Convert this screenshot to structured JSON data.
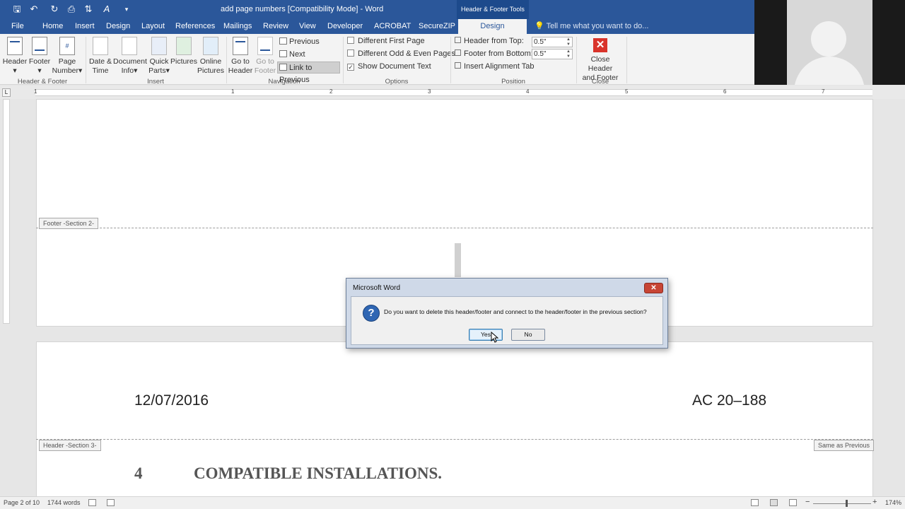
{
  "window": {
    "doc_title": "add page numbers [Compatibility Mode] - Word",
    "contextual_tab_group": "Header & Footer Tools",
    "qat": {
      "save": "🖫",
      "undo": "↶",
      "redo": "↻",
      "preview": "⎙",
      "sort": "⇅",
      "font": "A",
      "more": "▾"
    }
  },
  "tabs": [
    "File",
    "Home",
    "Insert",
    "Design",
    "Layout",
    "References",
    "Mailings",
    "Review",
    "View",
    "Developer",
    "ACROBAT",
    "SecureZIP",
    "Design"
  ],
  "tell_me": "Tell me what you want to do...",
  "ribbon": {
    "header_footer": {
      "header": "Header",
      "footer": "Footer",
      "page_number_1": "Page",
      "page_number_2": "Number",
      "group": "Header & Footer"
    },
    "insert": {
      "date_time_1": "Date &",
      "date_time_2": "Time",
      "doc_info_1": "Document",
      "doc_info_2": "Info",
      "quick_parts_1": "Quick",
      "quick_parts_2": "Parts",
      "pictures": "Pictures",
      "online_pictures_1": "Online",
      "online_pictures_2": "Pictures",
      "group": "Insert"
    },
    "navigation": {
      "go_to_header_1": "Go to",
      "go_to_header_2": "Header",
      "go_to_footer_1": "Go to",
      "go_to_footer_2": "Footer",
      "previous": "Previous",
      "next": "Next",
      "link_to_previous": "Link to Previous",
      "group": "Navigation"
    },
    "options": {
      "different_first_page": "Different First Page",
      "different_odd_even": "Different Odd & Even Pages",
      "show_document_text": "Show Document Text",
      "show_document_text_checked": true,
      "group": "Options"
    },
    "position": {
      "header_from_top_label": "Header from Top:",
      "header_from_top": "0.5\"",
      "footer_from_bottom_label": "Footer from Bottom:",
      "footer_from_bottom": "0.5\"",
      "insert_alignment_tab": "Insert Alignment Tab",
      "group": "Position"
    },
    "close": {
      "label_1": "Close Header",
      "label_2": "and Footer",
      "group": "Close"
    }
  },
  "ruler": {
    "marks": [
      "1",
      "1",
      "2",
      "3",
      "4",
      "5",
      "6",
      "7"
    ],
    "corner": "L"
  },
  "document": {
    "footer_tag": "Footer -Section 2-",
    "header_tag": "Header -Section 3-",
    "same_as_previous": "Same as Previous",
    "header_left": "12/07/2016",
    "header_right": "AC 20–188",
    "heading_number": "4",
    "heading_text": "COMPATIBLE INSTALLATIONS."
  },
  "dialog": {
    "title": "Microsoft Word",
    "message": "Do you want to delete this header/footer and connect to the header/footer in the previous section?",
    "yes": "Yes",
    "no": "No",
    "close": "✕"
  },
  "status": {
    "page": "Page 2 of 10",
    "words": "1744 words",
    "zoom": "174%",
    "zoom_minus": "−",
    "zoom_plus": "+"
  }
}
